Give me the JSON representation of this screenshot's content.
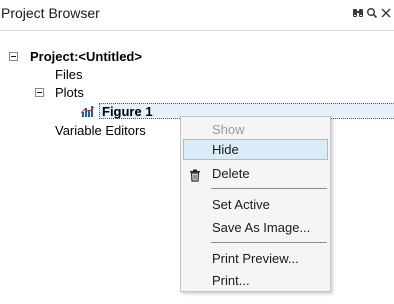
{
  "panel": {
    "title": "Project Browser",
    "header_icons": [
      "binoculars-icon",
      "search-icon",
      "close-icon"
    ]
  },
  "tree": {
    "project_label": "Project:<Untitled>",
    "files_label": "Files",
    "plots_label": "Plots",
    "figure_label": "Figure 1",
    "figure_icon": "plot-icon",
    "variable_editors_label": "Variable Editors"
  },
  "context_menu": {
    "show": "Show",
    "hide": "Hide",
    "delete": "Delete",
    "delete_icon": "trash-icon",
    "set_active": "Set Active",
    "save_as_image": "Save As Image...",
    "print_preview": "Print Preview...",
    "print": "Print..."
  },
  "colors": {
    "selection_bg": "#e6f2fb",
    "menu_hover_bg": "#d9ecf8",
    "menu_hover_border": "#8ec5e8",
    "plot_icon_bars": "#1f5fa8",
    "plot_icon_line": "#c0392b"
  }
}
